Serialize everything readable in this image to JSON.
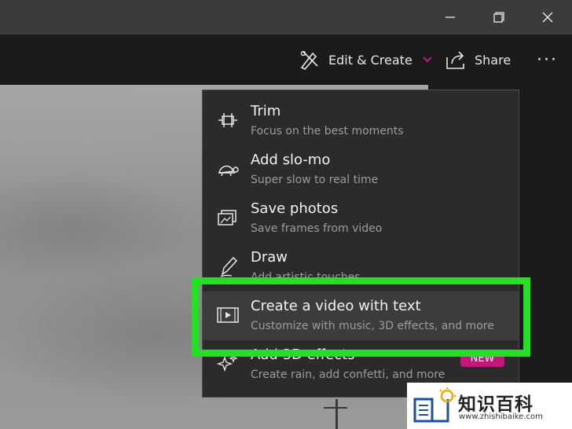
{
  "window": {
    "minimize_icon": "minimize-icon",
    "restore_icon": "restore-icon",
    "close_icon": "close-icon"
  },
  "toolbar": {
    "edit_create_label": "Edit & Create",
    "share_label": "Share",
    "more_label": "···",
    "accent": "#c2187c"
  },
  "menu": {
    "items": [
      {
        "title": "Trim",
        "subtitle": "Focus on the best moments",
        "icon": "trim-icon"
      },
      {
        "title": "Add slo-mo",
        "subtitle": "Super slow to real time",
        "icon": "turtle-icon"
      },
      {
        "title": "Save photos",
        "subtitle": "Save frames from video",
        "icon": "save-frames-icon"
      },
      {
        "title": "Draw",
        "subtitle": "Add artistic touches",
        "icon": "pen-icon"
      },
      {
        "title": "Create a video with text",
        "subtitle": "Customize with music, 3D effects, and more",
        "icon": "video-text-icon"
      },
      {
        "title": "Add 3D effects",
        "subtitle": "Create rain, add confetti, and more",
        "icon": "sparkle-icon",
        "badge": "NEW"
      }
    ]
  },
  "highlight_color": "#22e022",
  "watermark": {
    "text_cn": "知识百科",
    "url": "www.zhishibaike.com"
  }
}
